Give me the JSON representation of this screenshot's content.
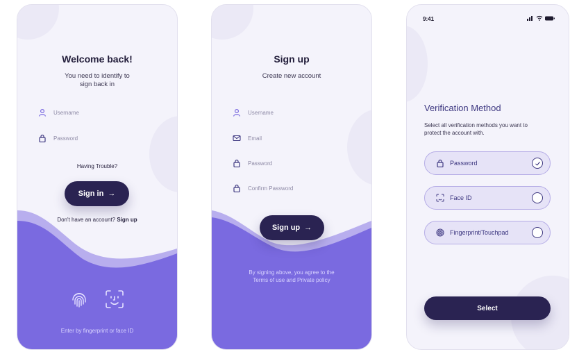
{
  "colors": {
    "accent": "#7a6ae0",
    "dark_button": "#2a2352",
    "screen_bg": "#f4f3fb",
    "option_bg": "#e6e3f7"
  },
  "login": {
    "title": "Welcome back!",
    "subtitle_line1": "You need to identify to",
    "subtitle_line2": "sign back in",
    "username_placeholder": "Username",
    "password_placeholder": "Password",
    "trouble": "Having Trouble?",
    "sign_in_label": "Sign in",
    "no_account": "Don't have an account?",
    "sign_up_link": "Sign up",
    "biometric_hint": "Enter by fingerprint or face ID"
  },
  "signup": {
    "title": "Sign up",
    "subtitle": "Create new account",
    "username_placeholder": "Username",
    "email_placeholder": "Email",
    "password_placeholder": "Password",
    "confirm_placeholder": "Confirm Password",
    "sign_up_label": "Sign up",
    "terms_line1": "By signing above, you agree to the",
    "terms_line2": "Terms of use and Private policy"
  },
  "verification": {
    "time": "9:41",
    "title": "Verification Method",
    "subtitle": "Select all verification methods you want to protect the account with.",
    "options": [
      {
        "label": "Password",
        "checked": true,
        "icon": "lock-icon"
      },
      {
        "label": "Face ID",
        "checked": false,
        "icon": "face-id-icon"
      },
      {
        "label": "Fingerprint/Touchpad",
        "checked": false,
        "icon": "fingerprint-icon"
      }
    ],
    "select_label": "Select"
  }
}
